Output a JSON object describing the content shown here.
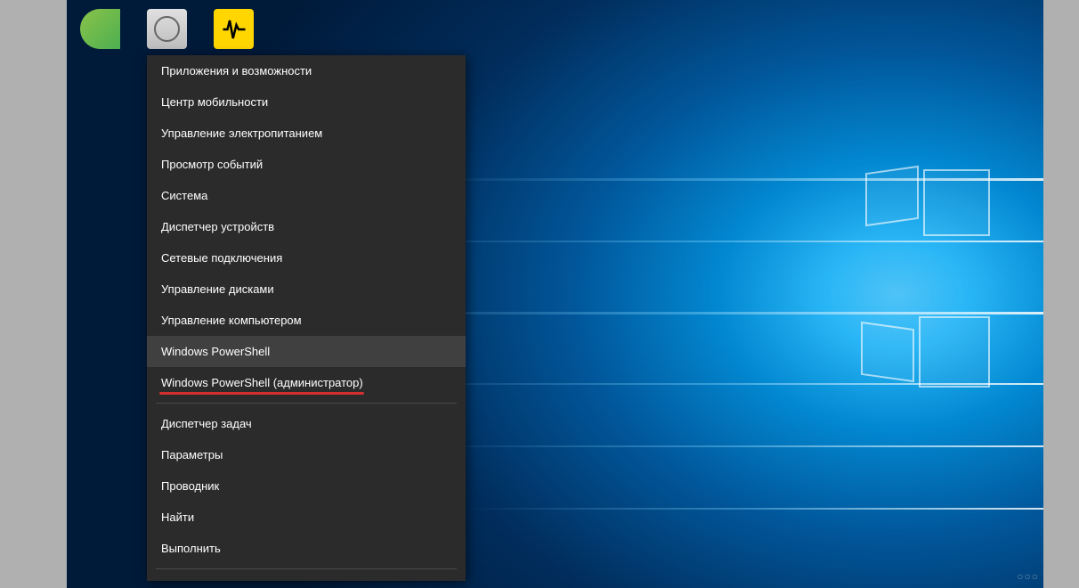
{
  "menu": {
    "groups": [
      {
        "items": [
          {
            "id": "apps-features",
            "label": "Приложения и возможности"
          },
          {
            "id": "mobility-center",
            "label": "Центр мобильности"
          },
          {
            "id": "power-options",
            "label": "Управление электропитанием"
          },
          {
            "id": "event-viewer",
            "label": "Просмотр событий"
          },
          {
            "id": "system",
            "label": "Система"
          },
          {
            "id": "device-manager",
            "label": "Диспетчер устройств"
          },
          {
            "id": "network-connections",
            "label": "Сетевые подключения"
          },
          {
            "id": "disk-management",
            "label": "Управление дисками"
          },
          {
            "id": "computer-management",
            "label": "Управление компьютером"
          },
          {
            "id": "powershell",
            "label": "Windows PowerShell",
            "hovered": true
          },
          {
            "id": "powershell-admin",
            "label": "Windows PowerShell (администратор)",
            "underlined": true
          }
        ]
      },
      {
        "items": [
          {
            "id": "task-manager",
            "label": "Диспетчер задач"
          },
          {
            "id": "settings",
            "label": "Параметры"
          },
          {
            "id": "file-explorer",
            "label": "Проводник"
          },
          {
            "id": "search",
            "label": "Найти"
          },
          {
            "id": "run",
            "label": "Выполнить"
          }
        ]
      }
    ]
  },
  "watermark": "○○○"
}
